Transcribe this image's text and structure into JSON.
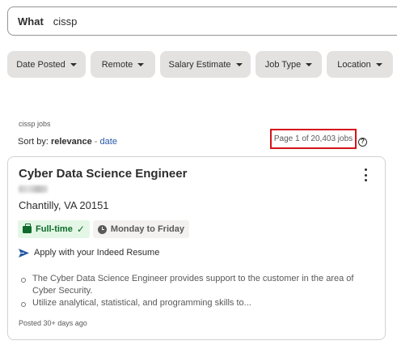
{
  "search": {
    "label": "What",
    "value": "cissp"
  },
  "filters": [
    {
      "label": "Date Posted"
    },
    {
      "label": "Remote"
    },
    {
      "label": "Salary Estimate"
    },
    {
      "label": "Job Type"
    },
    {
      "label": "Location"
    }
  ],
  "results": {
    "query_caption": "cissp jobs",
    "sort_prefix": "Sort by:",
    "sort_active": "relevance",
    "sort_separator": "-",
    "sort_alt": "date",
    "page_count": "Page 1 of 20,403 jobs",
    "help_glyph": "?"
  },
  "job": {
    "title": "Cyber Data Science Engineer",
    "location": "Chantilly, VA 20151",
    "tags": {
      "job_type": "Full-time",
      "check_glyph": "✓",
      "schedule": "Monday to Friday"
    },
    "apply_text": "Apply with your Indeed Resume",
    "snippet": [
      "The Cyber Data Science Engineer provides support to the customer in the area of Cyber Security.",
      "Utilize analytical, statistical, and programming skills to..."
    ],
    "posted": "Posted 30+ days ago"
  },
  "colors": {
    "accent_blue": "#2557a7",
    "highlight_red": "#d4141b",
    "tag_green": "#0d6b2c",
    "tag_green_bg": "#e4f7e6",
    "pill_bg": "#e4e2e0"
  }
}
